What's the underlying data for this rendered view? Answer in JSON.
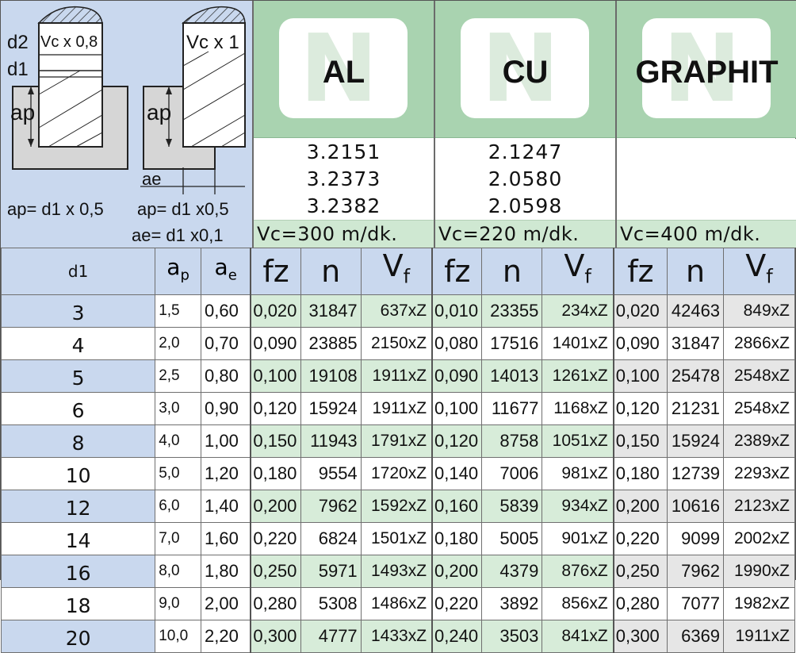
{
  "diagram": {
    "left_labels": {
      "d2": "d2",
      "vc_factor": "Vc x 0,8",
      "d1": "d1",
      "ap": "ap",
      "formula": "ap= d1 x 0,5"
    },
    "right_labels": {
      "vc_factor": "Vc x 1",
      "ap": "ap",
      "ae": "ae",
      "formula_ap": "ap= d1 x0,5",
      "formula_ae": "ae= d1 x0,1"
    }
  },
  "materials": [
    {
      "name": "AL",
      "grades": [
        "3.2151",
        "3.2373",
        "3.2382"
      ],
      "vc": "Vc=300 m/dk."
    },
    {
      "name": "CU",
      "grades": [
        "2.1247",
        "2.0580",
        "2.0598"
      ],
      "vc": "Vc=220 m/dk."
    },
    {
      "name": "GRAPHIT",
      "grades": [],
      "vc": "Vc=400 m/dk."
    }
  ],
  "headers": {
    "d1": "d1",
    "ap": "a",
    "ap_sub": "p",
    "ae": "a",
    "ae_sub": "e",
    "fz": "fz",
    "n": "n",
    "vf": "V",
    "vf_sub": "f"
  },
  "rows": [
    {
      "d1": "3",
      "ap": "1,5",
      "ae": "0,60",
      "al": [
        "0,020",
        "31847",
        "637xZ"
      ],
      "cu": [
        "0,010",
        "23355",
        "234xZ"
      ],
      "gr": [
        "0,020",
        "42463",
        "849xZ"
      ]
    },
    {
      "d1": "4",
      "ap": "2,0",
      "ae": "0,70",
      "al": [
        "0,090",
        "23885",
        "2150xZ"
      ],
      "cu": [
        "0,080",
        "17516",
        "1401xZ"
      ],
      "gr": [
        "0,090",
        "31847",
        "2866xZ"
      ]
    },
    {
      "d1": "5",
      "ap": "2,5",
      "ae": "0,80",
      "al": [
        "0,100",
        "19108",
        "1911xZ"
      ],
      "cu": [
        "0,090",
        "14013",
        "1261xZ"
      ],
      "gr": [
        "0,100",
        "25478",
        "2548xZ"
      ]
    },
    {
      "d1": "6",
      "ap": "3,0",
      "ae": "0,90",
      "al": [
        "0,120",
        "15924",
        "1911xZ"
      ],
      "cu": [
        "0,100",
        "11677",
        "1168xZ"
      ],
      "gr": [
        "0,120",
        "21231",
        "2548xZ"
      ]
    },
    {
      "d1": "8",
      "ap": "4,0",
      "ae": "1,00",
      "al": [
        "0,150",
        "11943",
        "1791xZ"
      ],
      "cu": [
        "0,120",
        "8758",
        "1051xZ"
      ],
      "gr": [
        "0,150",
        "15924",
        "2389xZ"
      ]
    },
    {
      "d1": "10",
      "ap": "5,0",
      "ae": "1,20",
      "al": [
        "0,180",
        "9554",
        "1720xZ"
      ],
      "cu": [
        "0,140",
        "7006",
        "981xZ"
      ],
      "gr": [
        "0,180",
        "12739",
        "2293xZ"
      ]
    },
    {
      "d1": "12",
      "ap": "6,0",
      "ae": "1,40",
      "al": [
        "0,200",
        "7962",
        "1592xZ"
      ],
      "cu": [
        "0,160",
        "5839",
        "934xZ"
      ],
      "gr": [
        "0,200",
        "10616",
        "2123xZ"
      ]
    },
    {
      "d1": "14",
      "ap": "7,0",
      "ae": "1,60",
      "al": [
        "0,220",
        "6824",
        "1501xZ"
      ],
      "cu": [
        "0,180",
        "5005",
        "901xZ"
      ],
      "gr": [
        "0,220",
        "9099",
        "2002xZ"
      ]
    },
    {
      "d1": "16",
      "ap": "8,0",
      "ae": "1,80",
      "al": [
        "0,250",
        "5971",
        "1493xZ"
      ],
      "cu": [
        "0,200",
        "4379",
        "876xZ"
      ],
      "gr": [
        "0,250",
        "7962",
        "1990xZ"
      ]
    },
    {
      "d1": "18",
      "ap": "9,0",
      "ae": "2,00",
      "al": [
        "0,280",
        "5308",
        "1486xZ"
      ],
      "cu": [
        "0,220",
        "3892",
        "856xZ"
      ],
      "gr": [
        "0,280",
        "7077",
        "1982xZ"
      ]
    },
    {
      "d1": "20",
      "ap": "10,0",
      "ae": "2,20",
      "al": [
        "0,300",
        "4777",
        "1433xZ"
      ],
      "cu": [
        "0,240",
        "3503",
        "841xZ"
      ],
      "gr": [
        "0,300",
        "6369",
        "1911xZ"
      ]
    }
  ],
  "colors": {
    "blue_band": "#c9d8ee",
    "green_band": "#a9d3b0",
    "green_row": "#d7ecd9",
    "grey_row": "#e6e6e6"
  }
}
